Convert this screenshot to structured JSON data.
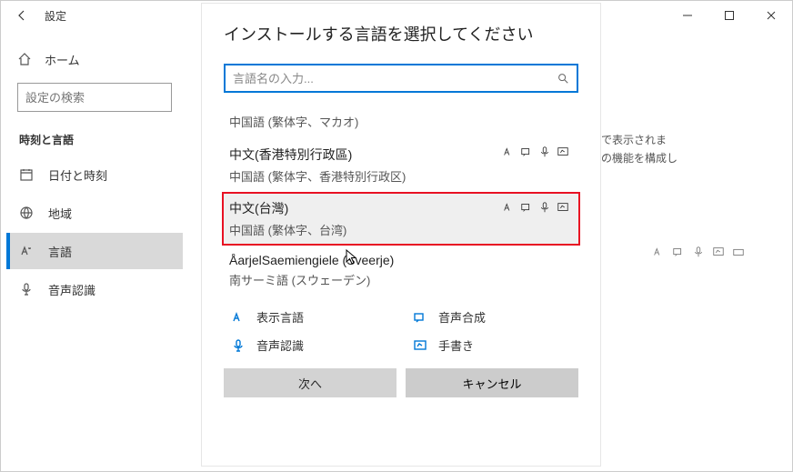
{
  "window": {
    "title": "設定",
    "minimize": "—",
    "maximize": "☐",
    "close": "✕"
  },
  "sidebar": {
    "home": "ホーム",
    "search_placeholder": "設定の検索",
    "category": "時刻と言語",
    "items": [
      {
        "label": "日付と時刻"
      },
      {
        "label": "地域"
      },
      {
        "label": "言語"
      },
      {
        "label": "音声認識"
      }
    ]
  },
  "background": {
    "line1": "の言語で表示されま",
    "line2": "その他の機能を構成し"
  },
  "dialog": {
    "title": "インストールする言語を選択してください",
    "search_placeholder": "言語名の入力...",
    "rows": [
      {
        "native": "",
        "local": "中国語 (繁体字、マカオ)"
      },
      {
        "native": "中文(香港特別行政區)",
        "local": "中国語 (繁体字、香港特別行政区)",
        "features": true
      },
      {
        "native": "中文(台灣)",
        "local": "中国語 (繁体字、台湾)",
        "features": true,
        "selected": true
      },
      {
        "native": "ÅarjelSaemiengiele (Sveerje)",
        "local": "南サーミ語 (スウェーデン)"
      }
    ],
    "legend": {
      "display": "表示言語",
      "tts": "音声合成",
      "speech": "音声認識",
      "handwriting": "手書き"
    },
    "next": "次へ",
    "cancel": "キャンセル"
  }
}
